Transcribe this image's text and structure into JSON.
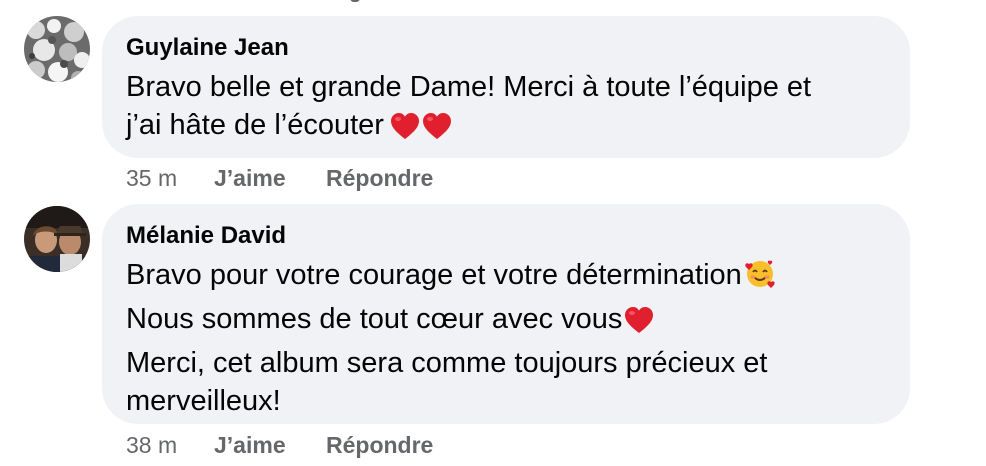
{
  "comments": [
    {
      "author": "Guylaine Jean",
      "lines": [
        "Bravo belle et grande Dame! Merci à toute l’équipe et",
        "j’ai hâte de l’écouter"
      ],
      "emojis": [
        "red-heart",
        "red-heart"
      ],
      "time": "35 m",
      "like_label": "J’aime",
      "reply_label": "Répondre"
    },
    {
      "author": "Mélanie David",
      "lines": [
        "Bravo pour votre courage et votre détermination",
        "Nous sommes de tout cœur avec vous",
        "Merci, cet album sera comme toujours précieux et",
        "merveilleux!"
      ],
      "emojis": [
        "smiling-face-with-hearts",
        "red-heart"
      ],
      "time": "38 m",
      "like_label": "J’aime",
      "reply_label": "Répondre"
    }
  ],
  "colors": {
    "bubble": "#f0f2f5",
    "text": "#050505",
    "secondary": "#65676b",
    "heart": "#e0202f"
  }
}
